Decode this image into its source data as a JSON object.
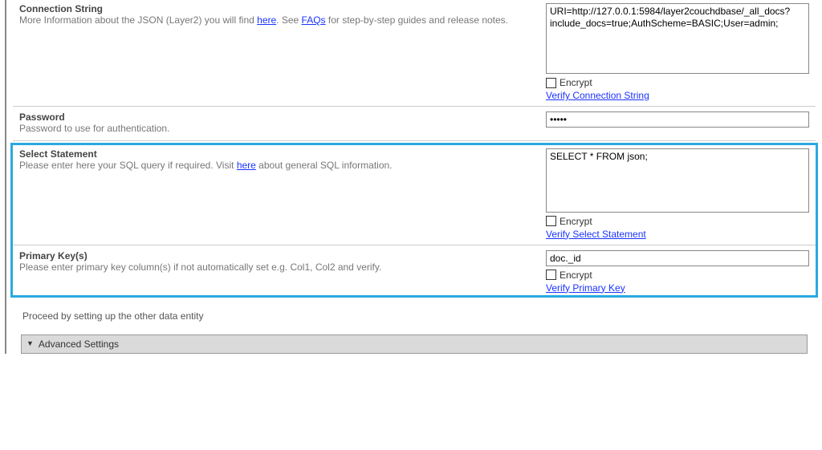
{
  "connString": {
    "title": "Connection String",
    "descPrefix": "More Information about the JSON (Layer2) you will find ",
    "hereLink": "here",
    "descMid": ". See ",
    "faqsLink": "FAQs",
    "descSuffix": " for step-by-step guides and release notes.",
    "value": "URI=http://127.0.0.1:5984/layer2couchdbase/_all_docs?include_docs=true;AuthScheme=BASIC;User=admin;",
    "encryptLabel": "Encrypt",
    "verifyLabel": "Verify Connection String"
  },
  "password": {
    "title": "Password",
    "desc": "Password to use for authentication.",
    "value": "•••••"
  },
  "selectStmt": {
    "title": "Select Statement",
    "descPrefix": "Please enter here your SQL query if required. Visit ",
    "hereLink": "here",
    "descSuffix": " about general SQL information.",
    "value": "SELECT * FROM json;",
    "encryptLabel": "Encrypt",
    "verifyLabel": "Verify Select Statement"
  },
  "primaryKey": {
    "title": "Primary Key(s)",
    "desc": "Please enter primary key column(s) if not automatically set e.g. Col1, Col2 and verify.",
    "value": "doc._id",
    "encryptLabel": "Encrypt",
    "verifyLabel": "Verify Primary Key"
  },
  "proceedText": "Proceed by setting up the other data entity",
  "advancedLabel": "Advanced Settings"
}
